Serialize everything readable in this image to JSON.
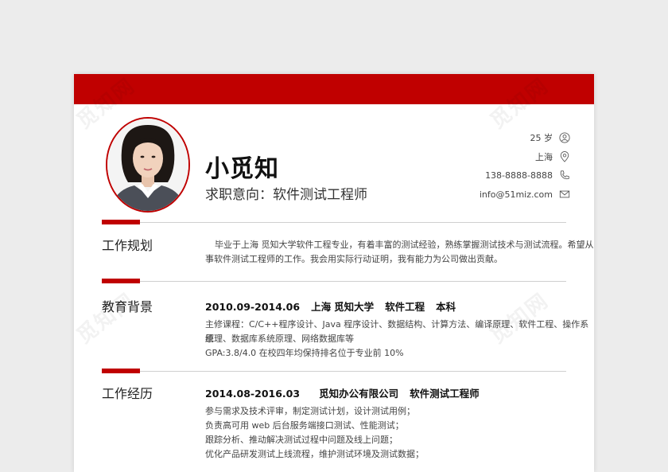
{
  "watermark": "觅知网",
  "header": {
    "name": "小觅知",
    "intent": "求职意向：软件测试工程师"
  },
  "contact": [
    {
      "text": "25 岁",
      "icon": "person-icon"
    },
    {
      "text": "上海",
      "icon": "location-icon"
    },
    {
      "text": "138-8888-8888",
      "icon": "phone-icon"
    },
    {
      "text": "info@51miz.com",
      "icon": "mail-icon"
    }
  ],
  "sections": {
    "plan": {
      "title": "工作规划",
      "line1": "毕业于上海  觅知大学软件工程专业，有着丰富的测试经验，熟练掌握测试技术与测试流程。希望从",
      "line2": "事软件测试工程师的工作。我会用实际行动证明，我有能力为公司做出贡献。"
    },
    "education": {
      "title": "教育背景",
      "period": "2010.09-2014.06",
      "city": "上海",
      "school": "觅知大学",
      "major": "软件工程",
      "degree": "本科",
      "courses1": "主修课程：C/C++程序设计、Java 程序设计、数据结构、计算方法、编译原理、软件工程、操作系统",
      "courses2": "原理、数据库系统原理、网络数据库等",
      "gpa": "GPA:3.8/4.0    在校四年均保持排名位于专业前 10%"
    },
    "experience": {
      "title": "工作经历",
      "period": "2014.08-2016.03",
      "company": "觅知办公有限公司",
      "role": "软件测试工程师",
      "items": [
        "参与需求及技术评审，制定测试计划，设计测试用例；",
        "负责高可用 web 后台服务端接口测试、性能测试；",
        "跟踪分析、推动解决测试过程中问题及线上问题；",
        "优化产品研发测试上线流程，维护测试环境及测试数据；"
      ]
    }
  },
  "colors": {
    "accent": "#c00000"
  }
}
